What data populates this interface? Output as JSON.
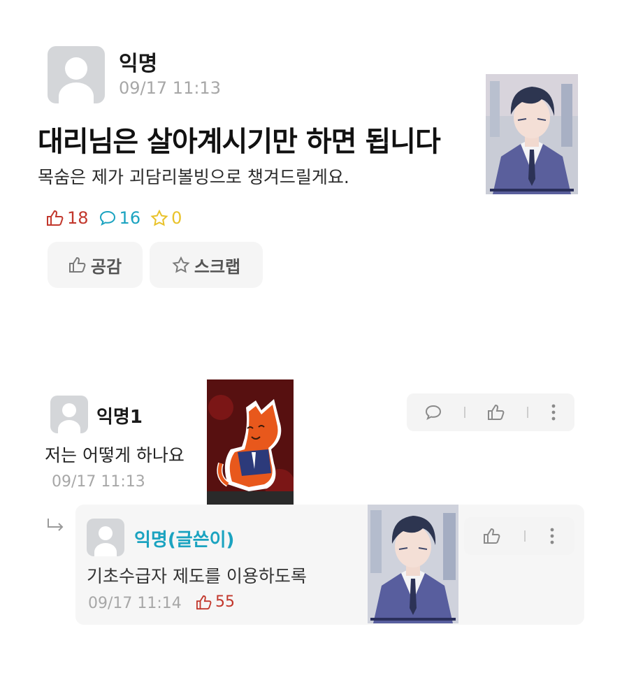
{
  "post": {
    "author": "익명",
    "time": "09/17 11:13",
    "title": "대리님은 살아계시기만 하면 됩니다",
    "body": "목숨은 제가 괴담리볼빙으로 챙겨드릴게요.",
    "likes": "18",
    "comments": "16",
    "scraps": "0",
    "like_button_label": "공감",
    "scrap_button_label": "스크랩"
  },
  "comments": [
    {
      "author": "익명1",
      "text": "저는 어떻게 하나요",
      "time": "09/17 11:13",
      "replies": [
        {
          "author": "익명(글쓴이)",
          "text": "기초수급자 제도를 이용하도록",
          "time": "09/17 11:14",
          "likes": "55"
        }
      ]
    }
  ],
  "colors": {
    "like": "#c2372c",
    "comment": "#1ba3c0",
    "scrap": "#e9c22a",
    "op_author": "#1ba3c0",
    "meta_gray": "#a7a7a7"
  },
  "icons": [
    "thumbs-up-icon",
    "speech-bubble-icon",
    "star-icon",
    "more-vertical-icon",
    "reply-arrow-icon"
  ]
}
